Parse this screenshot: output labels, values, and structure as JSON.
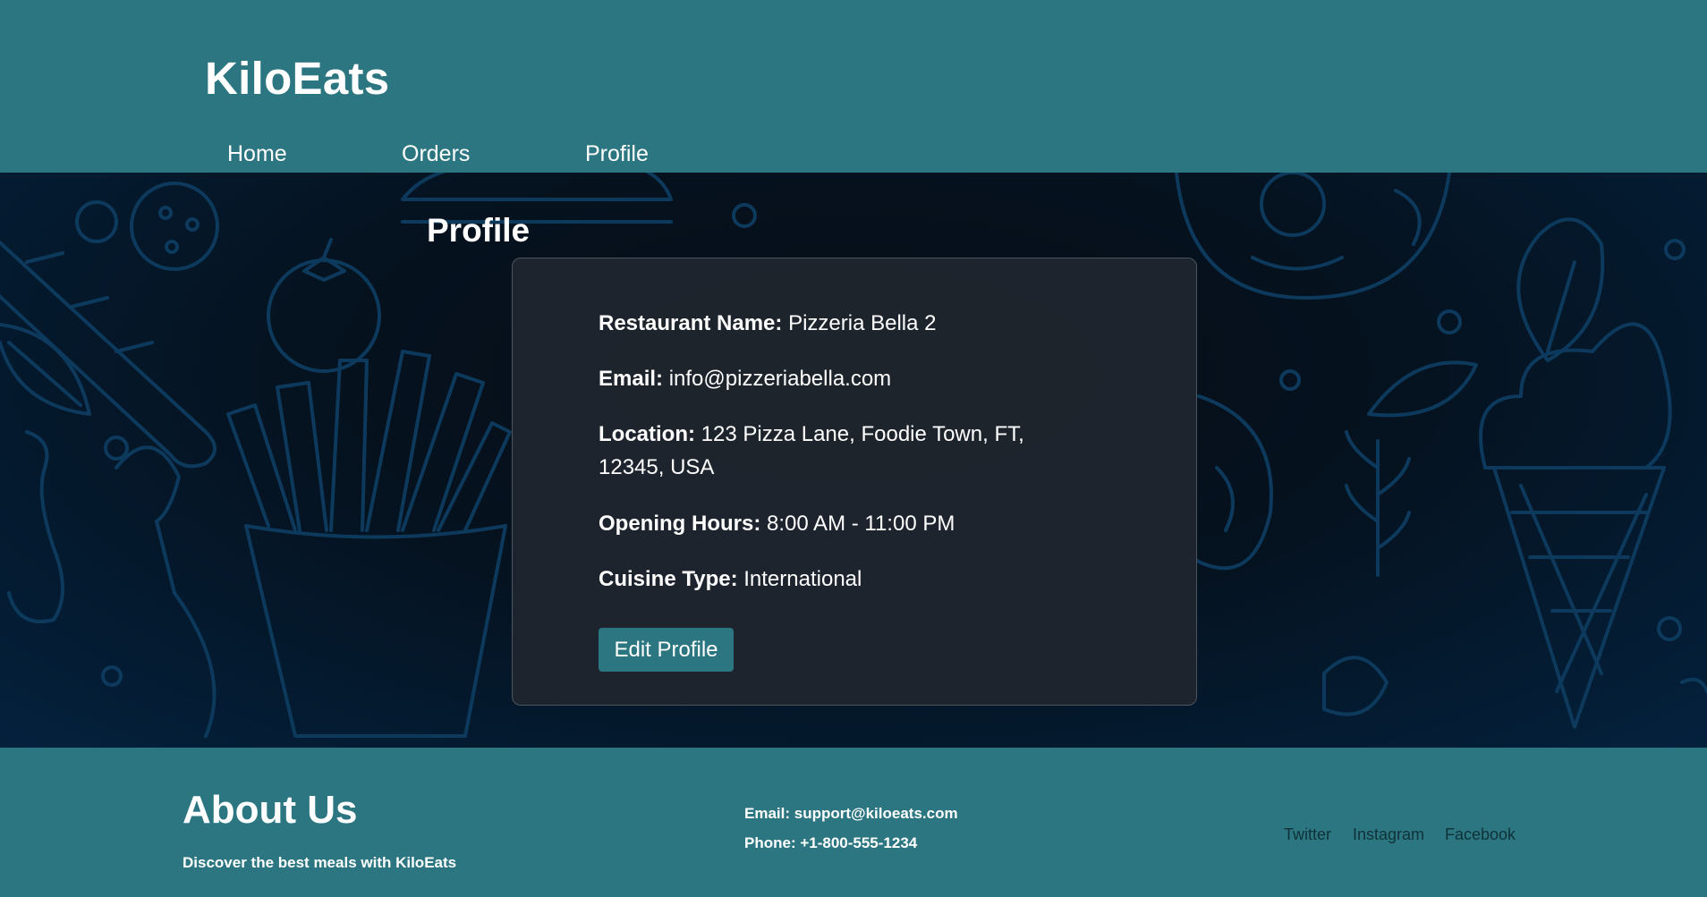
{
  "header": {
    "brand": "KiloEats",
    "nav": [
      {
        "label": "Home"
      },
      {
        "label": "Orders"
      },
      {
        "label": "Profile"
      }
    ]
  },
  "main": {
    "title": "Profile",
    "fields": [
      {
        "label": "Restaurant Name:",
        "value": "Pizzeria Bella 2"
      },
      {
        "label": "Email:",
        "value": "info@pizzeriabella.com"
      },
      {
        "label": "Location:",
        "value": "123 Pizza Lane, Foodie Town, FT, 12345, USA"
      },
      {
        "label": "Opening Hours:",
        "value": "8:00 AM - 11:00 PM"
      },
      {
        "label": "Cuisine Type:",
        "value": "International"
      }
    ],
    "edit_button": "Edit Profile"
  },
  "footer": {
    "about_title": "About Us",
    "about_text": "Discover the best meals with KiloEats",
    "email": "Email: support@kiloeats.com",
    "phone": "Phone: +1-800-555-1234",
    "social": [
      "Twitter",
      "Instagram",
      "Facebook"
    ]
  },
  "colors": {
    "primary": "#2c7681",
    "card_bg": "#20262e",
    "doodle": "#0d3a5c"
  }
}
